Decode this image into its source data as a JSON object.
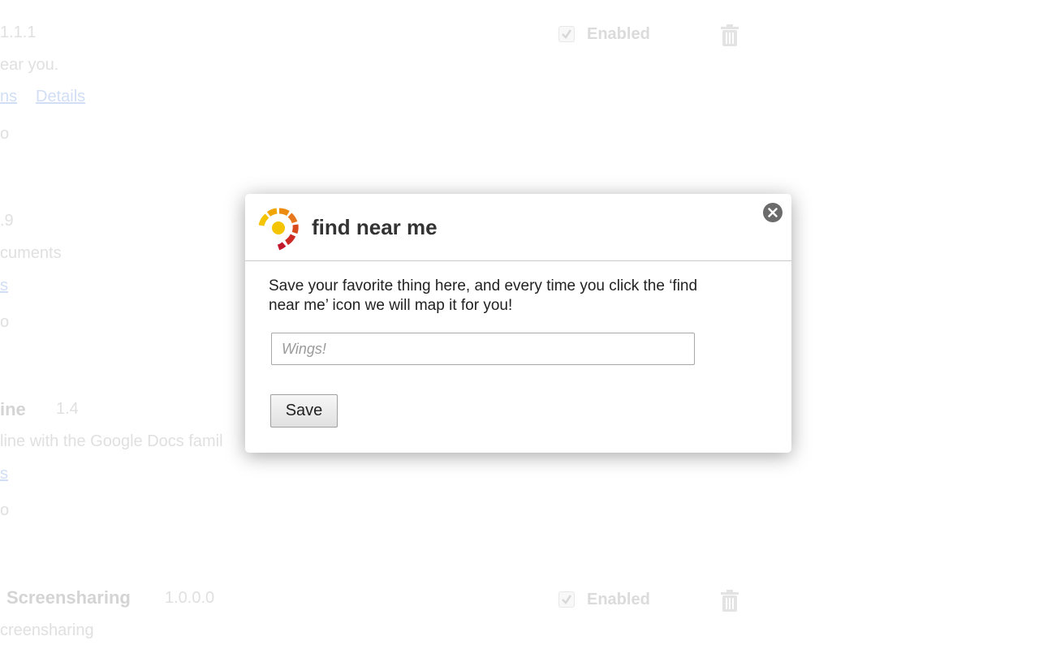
{
  "background": {
    "ext1": {
      "version": "1.1.1",
      "description": "ear you.",
      "link1": "ns",
      "link2": "Details",
      "options_fragment": "o",
      "enabled_label": "Enabled"
    },
    "ext2": {
      "version": ".9",
      "description": "cuments",
      "link": "s",
      "options_fragment": "o"
    },
    "ext3": {
      "title": "ine",
      "version": "1.4",
      "description": "line with the Google Docs famil",
      "link": "s",
      "options_fragment": "o"
    },
    "ext4": {
      "title": "Screensharing",
      "version": "1.0.0.0",
      "description": "creensharing",
      "enabled_label": "Enabled"
    }
  },
  "dialog": {
    "title": "find near me",
    "description": "Save your favorite thing here, and every time you click the ‘find near me’ icon we will map it for you!",
    "input": {
      "value": "",
      "placeholder": "Wings!"
    },
    "save_label": "Save",
    "logo_colors": [
      "#f5c400",
      "#f0a500",
      "#e8781e",
      "#d84a1b",
      "#c2182b"
    ]
  }
}
